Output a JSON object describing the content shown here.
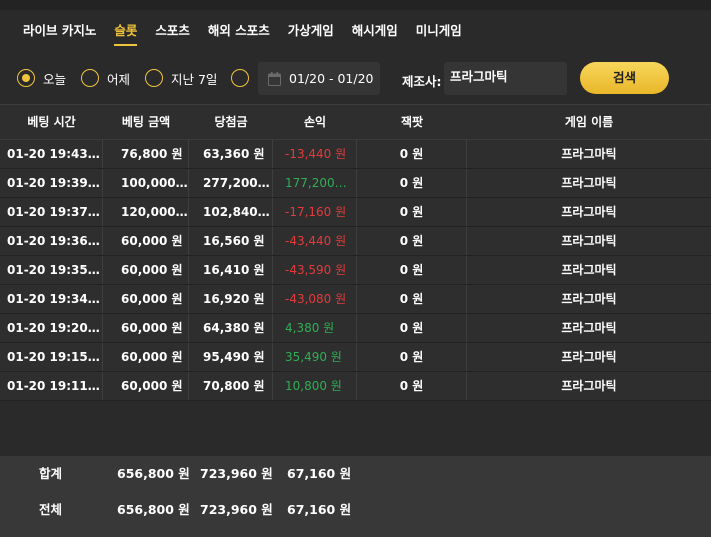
{
  "tabs": [
    {
      "label": "라이브 카지노",
      "active": false
    },
    {
      "label": "슬롯",
      "active": true
    },
    {
      "label": "스포츠",
      "active": false
    },
    {
      "label": "해외 스포츠",
      "active": false
    },
    {
      "label": "가상게임",
      "active": false
    },
    {
      "label": "해시게임",
      "active": false
    },
    {
      "label": "미니게임",
      "active": false
    }
  ],
  "filter": {
    "radios": [
      {
        "label": "오늘",
        "selected": true
      },
      {
        "label": "어제",
        "selected": false
      },
      {
        "label": "지난 7일",
        "selected": false
      },
      {
        "label": "",
        "selected": false
      }
    ],
    "date_range": "01/20 - 01/20",
    "maker_label": "제조사:",
    "maker_value": "프라그마틱",
    "search_label": "검색"
  },
  "table": {
    "headers": [
      "베팅 시간",
      "베팅 금액",
      "당첨금",
      "손익",
      "잭팟",
      "게임 이름"
    ],
    "rows": [
      {
        "time": "01-20 19:43:…",
        "bet": "76,800 원",
        "win": "63,360 원",
        "profit": "-13,440 원",
        "jackpot": "0 원",
        "game": "프라그마틱",
        "sign": "neg"
      },
      {
        "time": "01-20 19:39:…",
        "bet": "100,000…",
        "win": "277,200…",
        "profit": "177,200…",
        "jackpot": "0 원",
        "game": "프라그마틱",
        "sign": "pos"
      },
      {
        "time": "01-20 19:37:…",
        "bet": "120,000…",
        "win": "102,840…",
        "profit": "-17,160 원",
        "jackpot": "0 원",
        "game": "프라그마틱",
        "sign": "neg"
      },
      {
        "time": "01-20 19:36:…",
        "bet": "60,000 원",
        "win": "16,560 원",
        "profit": "-43,440 원",
        "jackpot": "0 원",
        "game": "프라그마틱",
        "sign": "neg"
      },
      {
        "time": "01-20 19:35:…",
        "bet": "60,000 원",
        "win": "16,410 원",
        "profit": "-43,590 원",
        "jackpot": "0 원",
        "game": "프라그마틱",
        "sign": "neg"
      },
      {
        "time": "01-20 19:34:…",
        "bet": "60,000 원",
        "win": "16,920 원",
        "profit": "-43,080 원",
        "jackpot": "0 원",
        "game": "프라그마틱",
        "sign": "neg"
      },
      {
        "time": "01-20 19:20:…",
        "bet": "60,000 원",
        "win": "64,380 원",
        "profit": "4,380 원",
        "jackpot": "0 원",
        "game": "프라그마틱",
        "sign": "pos"
      },
      {
        "time": "01-20 19:15:…",
        "bet": "60,000 원",
        "win": "95,490 원",
        "profit": "35,490 원",
        "jackpot": "0 원",
        "game": "프라그마틱",
        "sign": "pos"
      },
      {
        "time": "01-20 19:11:…",
        "bet": "60,000 원",
        "win": "70,800 원",
        "profit": "10,800 원",
        "jackpot": "0 원",
        "game": "프라그마틱",
        "sign": "pos"
      }
    ]
  },
  "summary": [
    {
      "label": "합계",
      "bet": "656,800 원",
      "win": "723,960 원",
      "profit": "67,160 원"
    },
    {
      "label": "전체",
      "bet": "656,800 원",
      "win": "723,960 원",
      "profit": "67,160 원"
    }
  ],
  "colors": {
    "accent": "#f0c33c",
    "negative": "#e33b3b",
    "positive": "#2fae55"
  }
}
